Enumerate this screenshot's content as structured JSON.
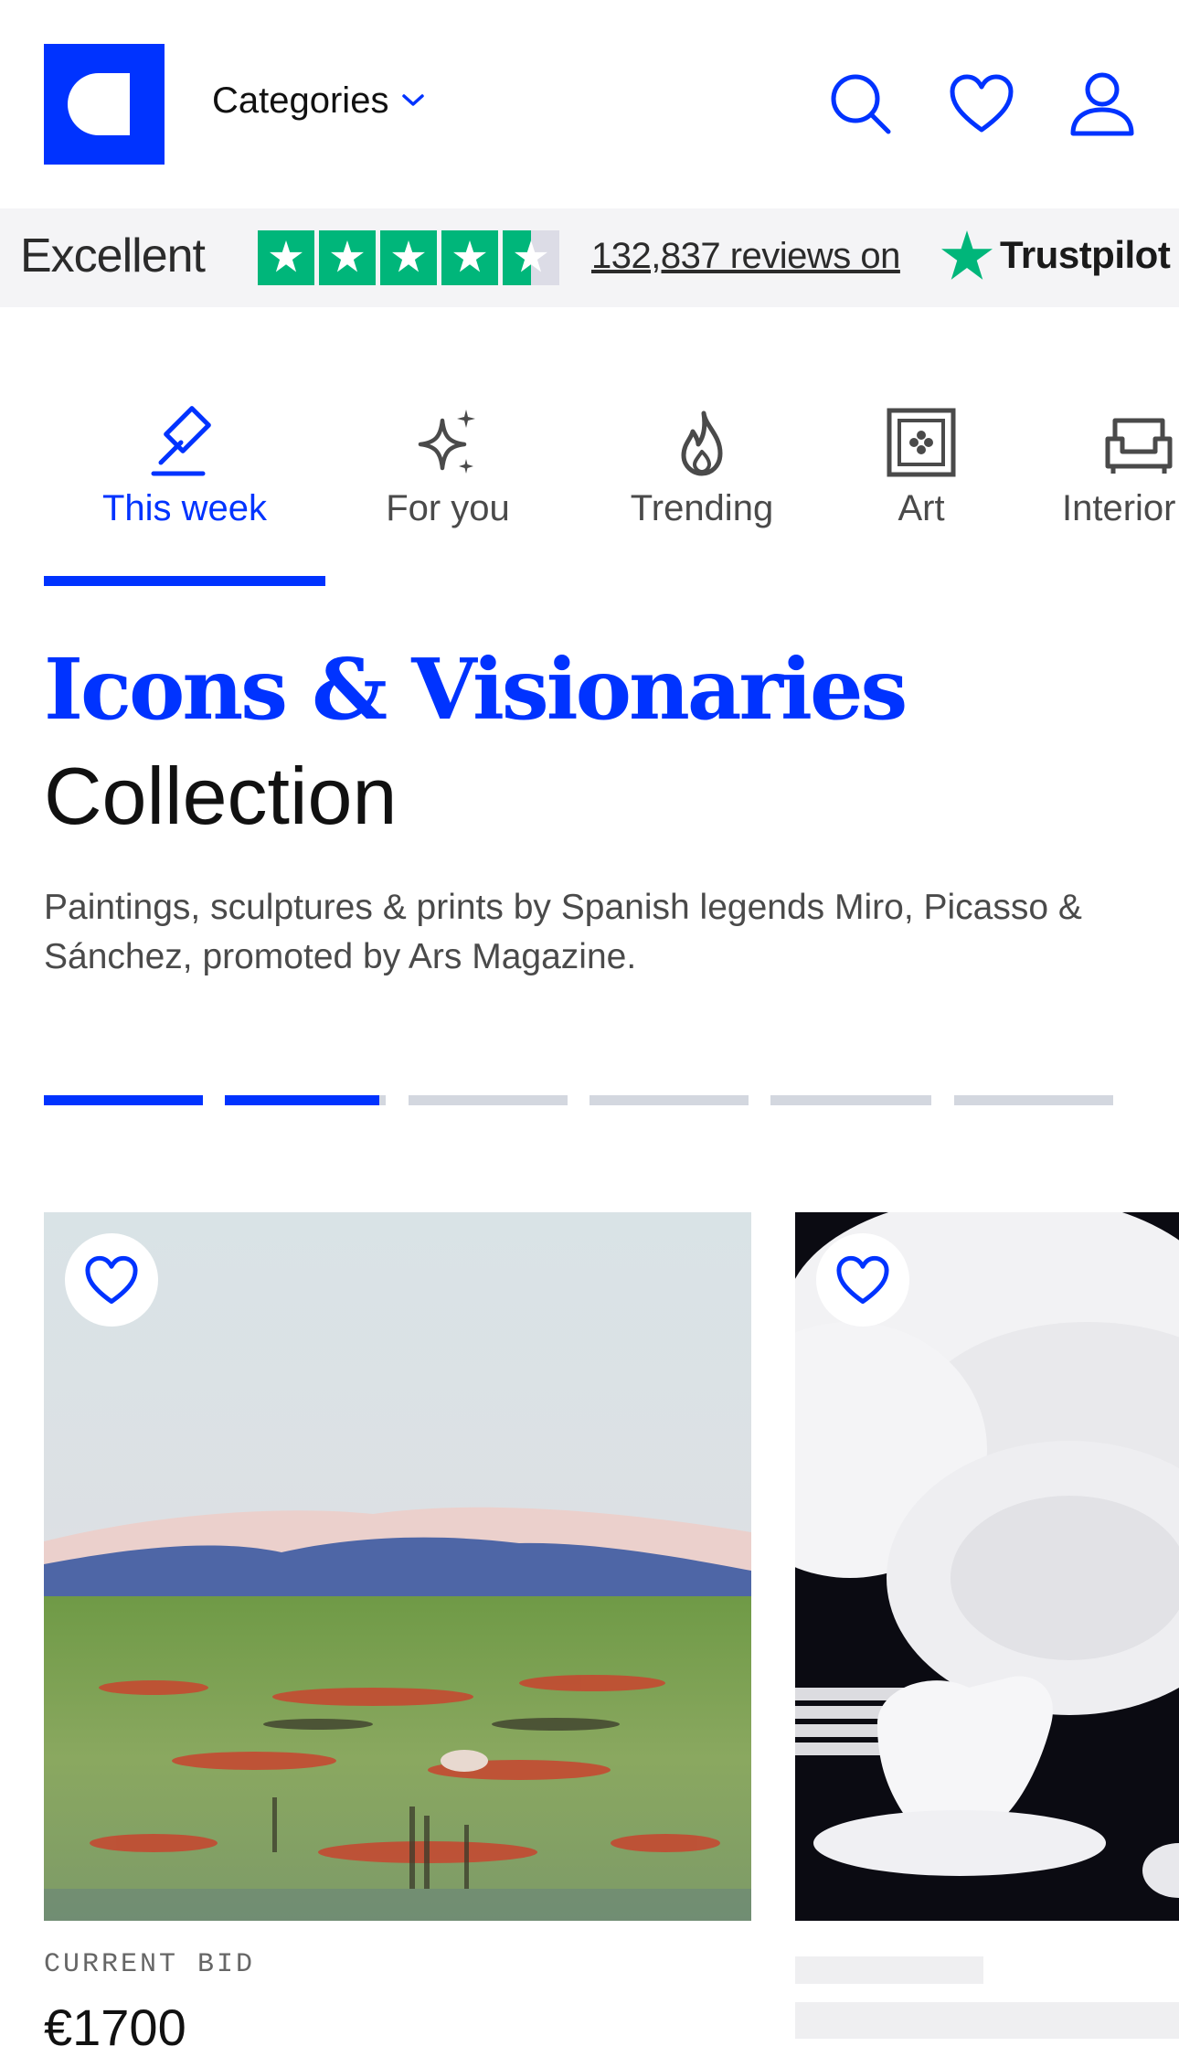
{
  "header": {
    "logo_icon": "brand-logo",
    "categories_label": "Categories",
    "icons": [
      "search-icon",
      "heart-icon",
      "user-icon"
    ],
    "accent_color": "#0033ff"
  },
  "trustpilot": {
    "rating_label": "Excellent",
    "reviews_text": "132,837 reviews on",
    "brand": "Trustpilot",
    "stars": 4.5,
    "star_color": "#00b67a"
  },
  "tabs": [
    {
      "label": "This week",
      "icon": "gavel-icon",
      "active": true
    },
    {
      "label": "For you",
      "icon": "sparkle-icon",
      "active": false
    },
    {
      "label": "Trending",
      "icon": "flame-icon",
      "active": false
    },
    {
      "label": "Art",
      "icon": "framed-art-icon",
      "active": false
    },
    {
      "label": "Interior",
      "icon": "sofa-icon",
      "active": false
    }
  ],
  "collection": {
    "title_highlight": "Icons & Visionaries",
    "title_rest": "Collection",
    "description": "Paintings, sculptures & prints by Spanish legends Miro, Picasso & Sánchez, promoted by Ars Magazine."
  },
  "carousel": {
    "segments_total": 6,
    "segments_filled": 2
  },
  "lots": [
    {
      "bid_label": "CURRENT BID",
      "price": "€1700",
      "image": "landscape-painting"
    },
    {
      "bid_label": "",
      "price": "",
      "image": "white-porcelain-tableware"
    }
  ]
}
